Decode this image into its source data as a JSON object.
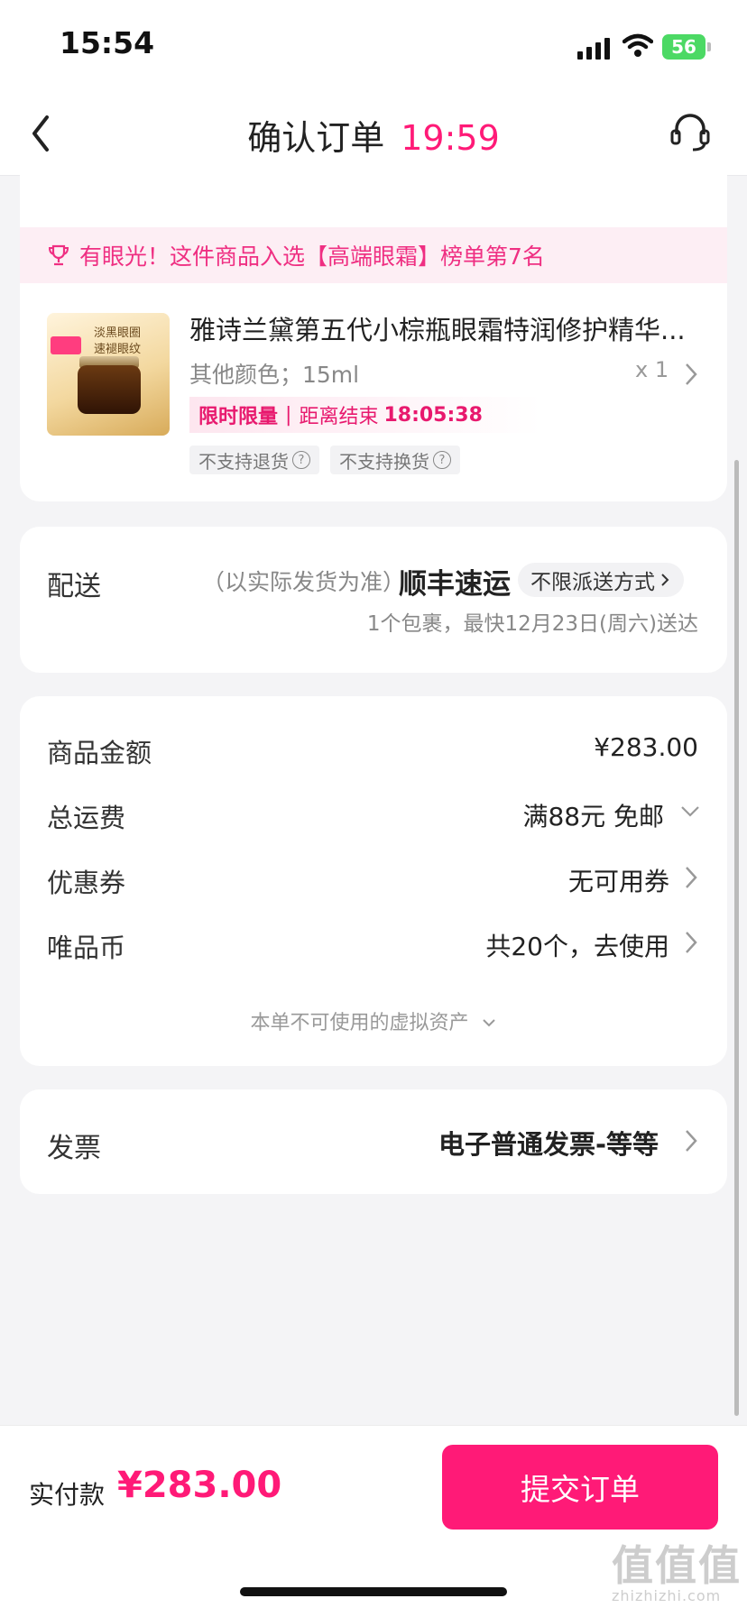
{
  "status_bar": {
    "time": "15:54",
    "battery": "56"
  },
  "nav": {
    "title": "确认订单",
    "countdown": "19:59"
  },
  "ranking_banner": {
    "text": "有眼光！这件商品入选【高端眼霜】榜单第7名"
  },
  "product": {
    "title": "雅诗兰黛第五代小棕瓶眼霜特润修护精华...",
    "spec": "其他颜色；15ml",
    "qty": "x 1",
    "thumb_text": "淡黑眼圈\n速褪眼纹",
    "flash_label": "限时限量",
    "flash_sep": "|",
    "flash_countdown_label": "距离结束",
    "flash_countdown": "18:05:38",
    "tags": [
      "不支持退货",
      "不支持换货"
    ]
  },
  "delivery": {
    "label": "配送",
    "note": "（以实际发货为准）",
    "courier": "顺丰速运",
    "method": "不限派送方式",
    "eta": "1个包裹，最快12月23日(周六)送达"
  },
  "price_rows": [
    {
      "label": "商品金额",
      "value": "¥283.00"
    },
    {
      "label": "总运费",
      "value": "满88元 免邮"
    },
    {
      "label": "优惠券",
      "value": "无可用券"
    },
    {
      "label": "唯品币",
      "value": "共20个，去使用"
    }
  ],
  "virtual_assets": "本单不可使用的虚拟资产",
  "invoice": {
    "label": "发票",
    "value": "电子普通发票-等等"
  },
  "bottom": {
    "pay_label": "实付款",
    "pay_amount": "¥283.00",
    "submit_label": "提交订单"
  },
  "watermark": {
    "main": "值值值",
    "sub": "zhizhizhi.com"
  },
  "colors": {
    "accent": "#ff1a77",
    "banner_bg": "#fdeef4",
    "page_bg": "#f4f4f6"
  }
}
